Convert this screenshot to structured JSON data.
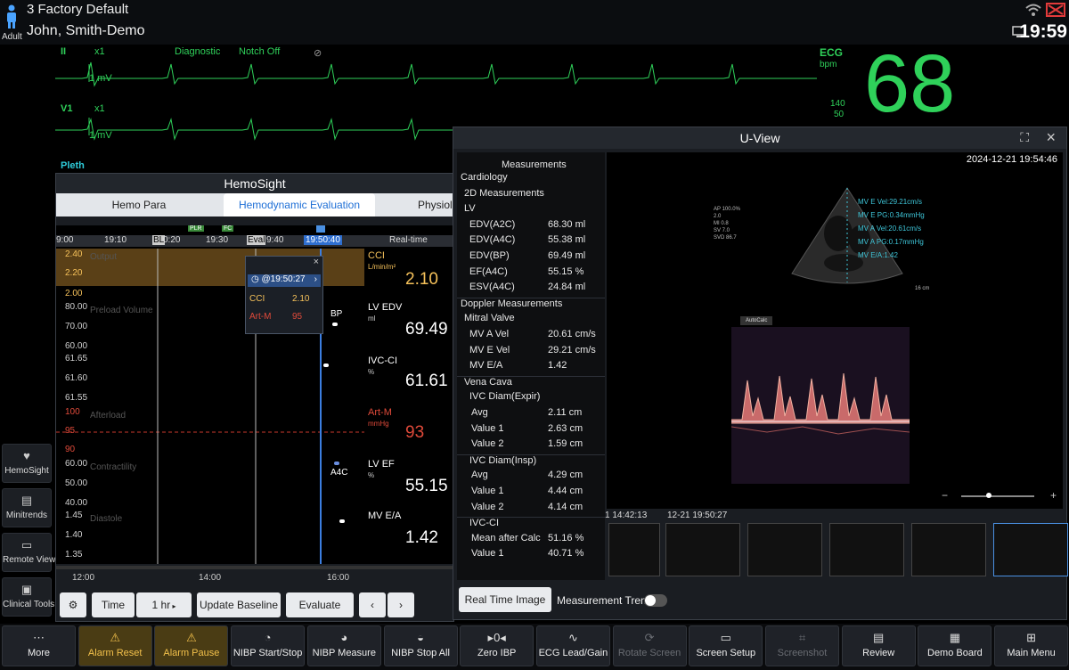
{
  "header": {
    "bed": "3  Factory Default",
    "patient_name": "John, Smith-Demo",
    "patient_type": "Adult",
    "time": "19:59"
  },
  "waves": {
    "ii": {
      "label": "II",
      "scale": "x1",
      "mode": "Diagnostic",
      "notch": "Notch Off",
      "mv": "1 mV"
    },
    "v1": {
      "label": "V1",
      "scale": "x1",
      "mv": "1 mV"
    },
    "pleth": {
      "label": "Pleth"
    }
  },
  "ecg_param": {
    "label": "ECG",
    "unit": "bpm",
    "high": "140",
    "low": "50",
    "value": "68"
  },
  "sidebar": [
    {
      "label": "HemoSight",
      "icon": "hemosight-icon"
    },
    {
      "label": "Minitrends",
      "icon": "minitrends-icon"
    },
    {
      "label": "Remote View",
      "icon": "remote-view-icon"
    },
    {
      "label": "Clinical Tools",
      "icon": "clinical-tools-icon"
    }
  ],
  "hemosight": {
    "title": "HemoSight",
    "tabs": [
      "Hemo Para",
      "Hemodynamic Evaluation",
      "Physiolo"
    ],
    "markers": [
      "PLR",
      "FC"
    ],
    "ruler": [
      "9:00",
      "19:10",
      "BL",
      "19:30",
      "Eval",
      "19:50:40",
      "Real-time"
    ],
    "ruler_extra": "0:20",
    "ruler_extra2": "9:40",
    "zones": [
      "Output",
      "Preload Volume",
      "Afterload",
      "Contractility",
      "Diastole"
    ],
    "yticks": [
      "2.40",
      "2.20",
      "2.00",
      "80.00",
      "70.00",
      "60.00",
      "61.65",
      "61.60",
      "61.55",
      "100",
      "95",
      "90",
      "60.00",
      "50.00",
      "40.00",
      "1.45",
      "1.40",
      "1.35"
    ],
    "xlabels": [
      "12:00",
      "14:00",
      "16:00"
    ],
    "params": [
      {
        "name": "CCI",
        "unit": "L/min/m²",
        "value": "2.10"
      },
      {
        "name": "LV EDV",
        "unit": "ml",
        "value": "69.49"
      },
      {
        "name": "IVC-CI",
        "unit": "%",
        "value": "61.61"
      },
      {
        "name": "Art-M",
        "unit": "mmHg",
        "value": "93"
      },
      {
        "name": "LV EF",
        "unit": "%",
        "value": "55.15"
      },
      {
        "name": "MV E/A",
        "unit": "",
        "value": "1.42"
      }
    ],
    "event_labels": [
      "BP",
      "A4C"
    ],
    "tooltip": {
      "time": "@19:50:27",
      "rows": [
        {
          "name": "CCI",
          "value": "2.10"
        },
        {
          "name": "Art-M",
          "value": "95"
        }
      ]
    },
    "buttons": {
      "time": "Time",
      "time_value": "1 hr",
      "update": "Update Baseline",
      "evaluate": "Evaluate"
    }
  },
  "uview": {
    "title": "U-View",
    "timestamp": "2024-12-21   19:54:46",
    "measurements_title": "Measurements",
    "measurements": [
      {
        "k": "Cardiology",
        "v": "",
        "indent": 0,
        "type": "header"
      },
      {
        "k": "2D Measurements",
        "v": "",
        "indent": 1,
        "type": "header"
      },
      {
        "k": "LV",
        "v": "",
        "indent": 1,
        "type": "header"
      },
      {
        "k": "EDV(A2C)",
        "v": "68.30 ml",
        "indent": 2,
        "type": "row"
      },
      {
        "k": "EDV(A4C)",
        "v": "55.38 ml",
        "indent": 2,
        "type": "row"
      },
      {
        "k": "EDV(BP)",
        "v": "69.49 ml",
        "indent": 2,
        "type": "row"
      },
      {
        "k": "EF(A4C)",
        "v": "55.15 %",
        "indent": 2,
        "type": "row"
      },
      {
        "k": "ESV(A4C)",
        "v": "24.84 ml",
        "indent": 2,
        "type": "row"
      },
      {
        "k": "Doppler Measurements",
        "v": "",
        "indent": 0,
        "type": "section"
      },
      {
        "k": "Mitral Valve",
        "v": "",
        "indent": 1,
        "type": "header"
      },
      {
        "k": "MV A Vel",
        "v": "20.61 cm/s",
        "indent": 2,
        "type": "row"
      },
      {
        "k": "MV E Vel",
        "v": "29.21 cm/s",
        "indent": 2,
        "type": "row"
      },
      {
        "k": "MV E/A",
        "v": "1.42",
        "indent": 2,
        "type": "row"
      },
      {
        "k": "Vena Cava",
        "v": "",
        "indent": 1,
        "type": "section"
      },
      {
        "k": "IVC Diam(Expir)",
        "v": "",
        "indent": 2,
        "type": "header"
      },
      {
        "k": "Avg",
        "v": "2.11 cm",
        "indent": 3,
        "type": "row"
      },
      {
        "k": "Value 1",
        "v": "2.63 cm",
        "indent": 3,
        "type": "row"
      },
      {
        "k": "Value 2",
        "v": "1.59 cm",
        "indent": 3,
        "type": "row"
      },
      {
        "k": "IVC Diam(Insp)",
        "v": "",
        "indent": 2,
        "type": "section"
      },
      {
        "k": "Avg",
        "v": "4.29 cm",
        "indent": 3,
        "type": "row"
      },
      {
        "k": "Value 1",
        "v": "4.44 cm",
        "indent": 3,
        "type": "row"
      },
      {
        "k": "Value 2",
        "v": "4.14 cm",
        "indent": 3,
        "type": "row"
      },
      {
        "k": "IVC-CI",
        "v": "",
        "indent": 2,
        "type": "section"
      },
      {
        "k": "Mean after Calc",
        "v": "51.16 %",
        "indent": 3,
        "type": "row"
      },
      {
        "k": "Value 1",
        "v": "40.71 %",
        "indent": 3,
        "type": "row"
      }
    ],
    "image_meas": [
      "MV E Vel:29.21cm/s",
      "MV E PG:0.34mmHg",
      "MV A Vel:20.61cm/s",
      "MV A PG:0.17mmHg",
      "MV E/A:1.42"
    ],
    "image_info": [
      "AP 100.0%",
      "2.0",
      "MI 0.8",
      "SV 7.0",
      "SVD 86.7"
    ],
    "depth": "16 cm",
    "autocalc": "AutoCalc",
    "thumb_labels": [
      "1 14:42:13",
      "12-21 19:50:27"
    ],
    "buttons": {
      "realtime": "Real Time Image",
      "trend": "Measurement Trend:"
    }
  },
  "toolbar": [
    {
      "label": "More",
      "icon": "more-icon",
      "state": "normal"
    },
    {
      "label": "Alarm Reset",
      "icon": "alarm-reset-icon",
      "state": "alarm"
    },
    {
      "label": "Alarm Pause",
      "icon": "alarm-pause-icon",
      "state": "alarm"
    },
    {
      "label": "NIBP Start/Stop",
      "icon": "nibp-start-icon",
      "state": "normal"
    },
    {
      "label": "NIBP Measure",
      "icon": "nibp-measure-icon",
      "state": "normal"
    },
    {
      "label": "NIBP Stop All",
      "icon": "nibp-stop-icon",
      "state": "normal"
    },
    {
      "label": "Zero IBP",
      "icon": "zero-ibp-icon",
      "state": "normal"
    },
    {
      "label": "ECG Lead/Gain",
      "icon": "ecg-lead-icon",
      "state": "normal"
    },
    {
      "label": "Rotate Screen",
      "icon": "rotate-screen-icon",
      "state": "disabled"
    },
    {
      "label": "Screen Setup",
      "icon": "screen-setup-icon",
      "state": "normal"
    },
    {
      "label": "Screenshot",
      "icon": "screenshot-icon",
      "state": "disabled"
    },
    {
      "label": "Review",
      "icon": "review-icon",
      "state": "normal"
    },
    {
      "label": "Demo Board",
      "icon": "demo-board-icon",
      "state": "normal"
    },
    {
      "label": "Main Menu",
      "icon": "main-menu-icon",
      "state": "normal"
    }
  ]
}
